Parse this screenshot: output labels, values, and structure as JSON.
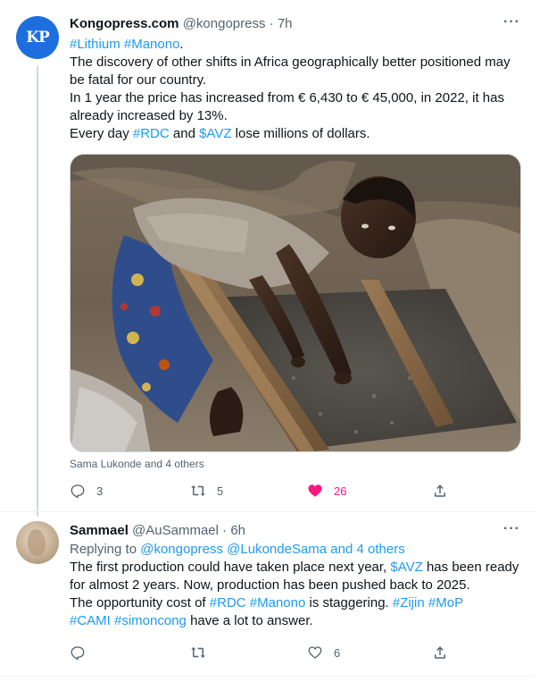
{
  "tweet1": {
    "avatar_text": "KP",
    "name": "Kongopress.com",
    "handle": "@kongopress",
    "time": "7h",
    "more_label": "···",
    "lines": [
      [
        {
          "t": " #Lithium #Manono",
          "link": true
        },
        {
          "t": "."
        }
      ],
      [
        {
          "t": "The discovery of other shifts in Africa geographically better positioned may"
        }
      ],
      [
        {
          "t": "be fatal for our country."
        }
      ],
      [
        {
          "t": "In 1 year the price has increased from € 6,430 to € 45,000, in 2022, it has"
        }
      ],
      [
        {
          "t": "already increased by 13%."
        }
      ],
      [
        {
          "t": "Every day "
        },
        {
          "t": "#RDC",
          "link": true
        },
        {
          "t": " and "
        },
        {
          "t": "$AVZ",
          "link": true
        },
        {
          "t": " lose millions of dollars."
        }
      ]
    ],
    "tagged": "Sama Lukonde and 4 others",
    "reply_count": "3",
    "retweet_count": "5",
    "like_count": "26",
    "share_count": ""
  },
  "tweet2": {
    "name": "Sammael",
    "handle": "@AuSammael",
    "time": "6h",
    "more_label": "···",
    "lines": [
      [
        {
          "t": "Replying to ",
          "muted": true
        },
        {
          "t": "@kongopress @LukondeSama and 4 others",
          "link": true
        }
      ],
      [
        {
          "t": "The first production could have taken place next year, "
        },
        {
          "t": "$AVZ",
          "link": true
        },
        {
          "t": " has been ready"
        }
      ],
      [
        {
          "t": "for almost 2 years. Now, production has been pushed back to 2025."
        }
      ],
      [
        {
          "t": "The opportunity cost of "
        },
        {
          "t": "#RDC #Manono",
          "link": true
        },
        {
          "t": "  is staggering.   "
        },
        {
          "t": "#Zijin #MoP",
          "link": true
        }
      ],
      [
        {
          "t": "#CAMI #simoncong",
          "link": true
        },
        {
          "t": " have a lot to answer."
        }
      ]
    ],
    "reply_count": "",
    "retweet_count": "",
    "like_count": "6",
    "share_count": ""
  },
  "colors": {
    "accent": "#1d9bf0",
    "like": "#f91880",
    "muted": "#536471",
    "text": "#0f1419"
  }
}
